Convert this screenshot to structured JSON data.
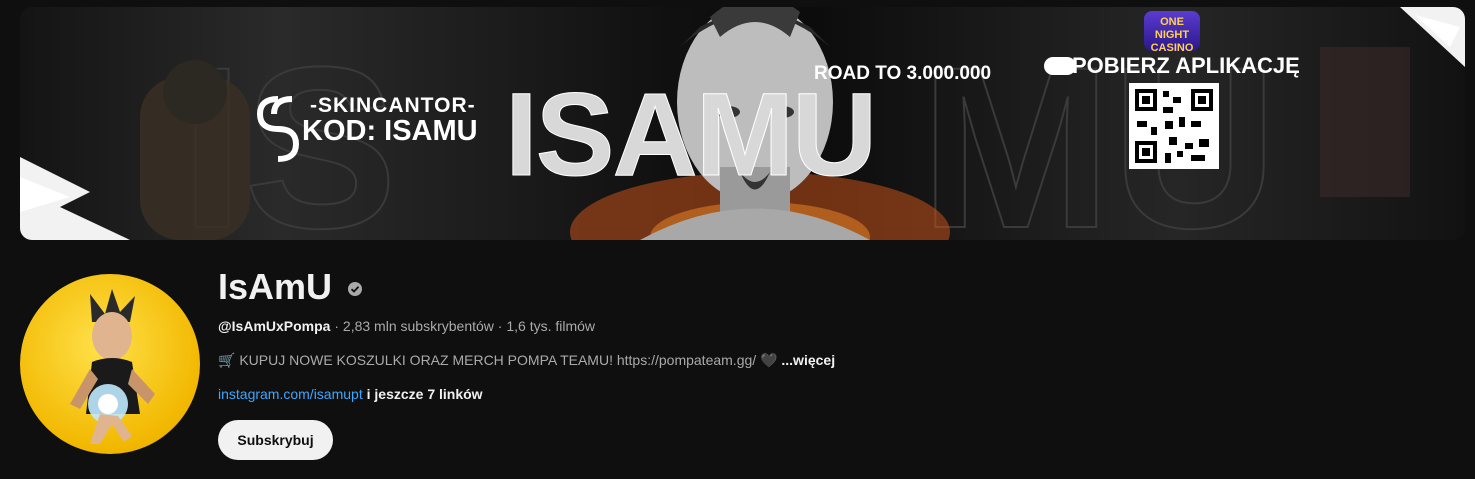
{
  "banner": {
    "skin_line1": "-SKINCANTOR-",
    "skin_line2": "KOD: ISAMU",
    "big_name": "ISAMU",
    "road": "ROAD TO 3.000.000",
    "download": "POBIERZ APLIKACJĘ",
    "casino_logo": "ONE NIGHT CASINO"
  },
  "channel": {
    "name": "IsAmU",
    "handle": "@IsAmUxPompa",
    "subscribers": "2,83 mln subskrybentów",
    "videos": "1,6 tys. filmów",
    "description": "KUPUJ NOWE KOSZULKI ORAZ MERCH POMPA TEAMU! https://pompateam.gg/",
    "more_label": "...więcej",
    "link": "instagram.com/isamupt",
    "more_links": "i jeszcze 7 linków",
    "subscribe_label": "Subskrybuj"
  },
  "colors": {
    "background": "#0f0f0f",
    "link": "#3ea6ff",
    "avatar_bg": "#f2b800",
    "text_secondary": "#aaaaaa"
  }
}
